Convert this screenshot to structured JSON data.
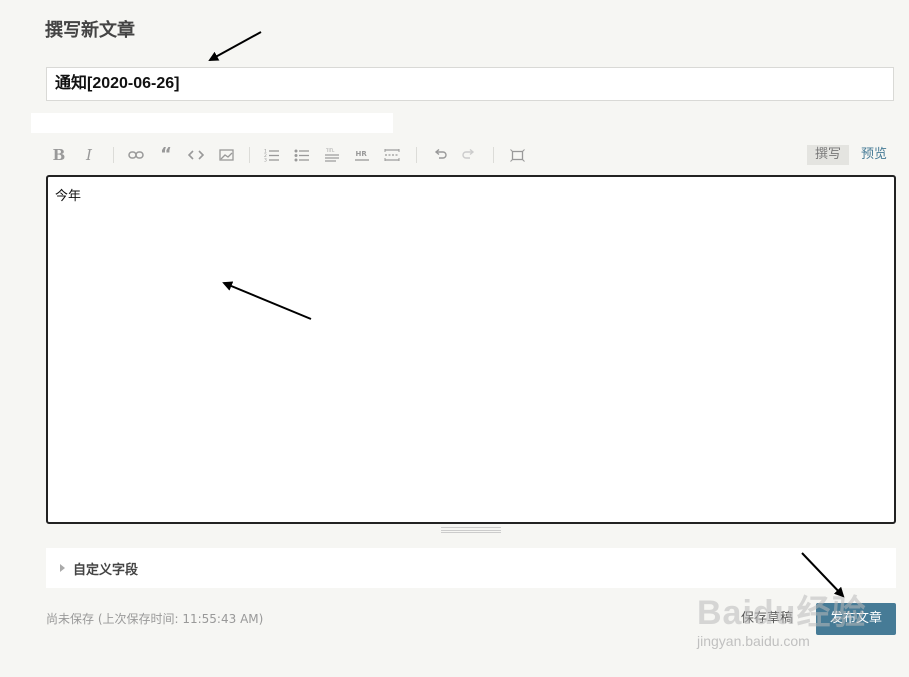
{
  "page": {
    "title": "撰写新文章"
  },
  "title_input": {
    "value": "通知[2020-06-26]"
  },
  "toolbar": {
    "buttons": [
      "bold-icon",
      "italic-icon",
      "link-icon",
      "quote-icon",
      "code-icon",
      "image-icon",
      "ordered-list-icon",
      "unordered-list-icon",
      "heading-icon",
      "hr-icon",
      "more-icon",
      "undo-icon",
      "redo-icon",
      "fullscreen-icon"
    ],
    "tab_write": "撰写",
    "tab_preview": "预览"
  },
  "editor": {
    "content": "今年"
  },
  "custom_fields": {
    "label": "自定义字段"
  },
  "footer": {
    "save_status": "尚未保存 (上次保存时间: 11:55:43 AM)",
    "save_draft": "保存草稿",
    "publish": "发布文章"
  },
  "watermark": {
    "brand": "Baidu经验",
    "url": "jingyan.baidu.com"
  },
  "colors": {
    "accent": "#467b96",
    "background": "#f6f6f3",
    "editor_border": "#222222"
  }
}
